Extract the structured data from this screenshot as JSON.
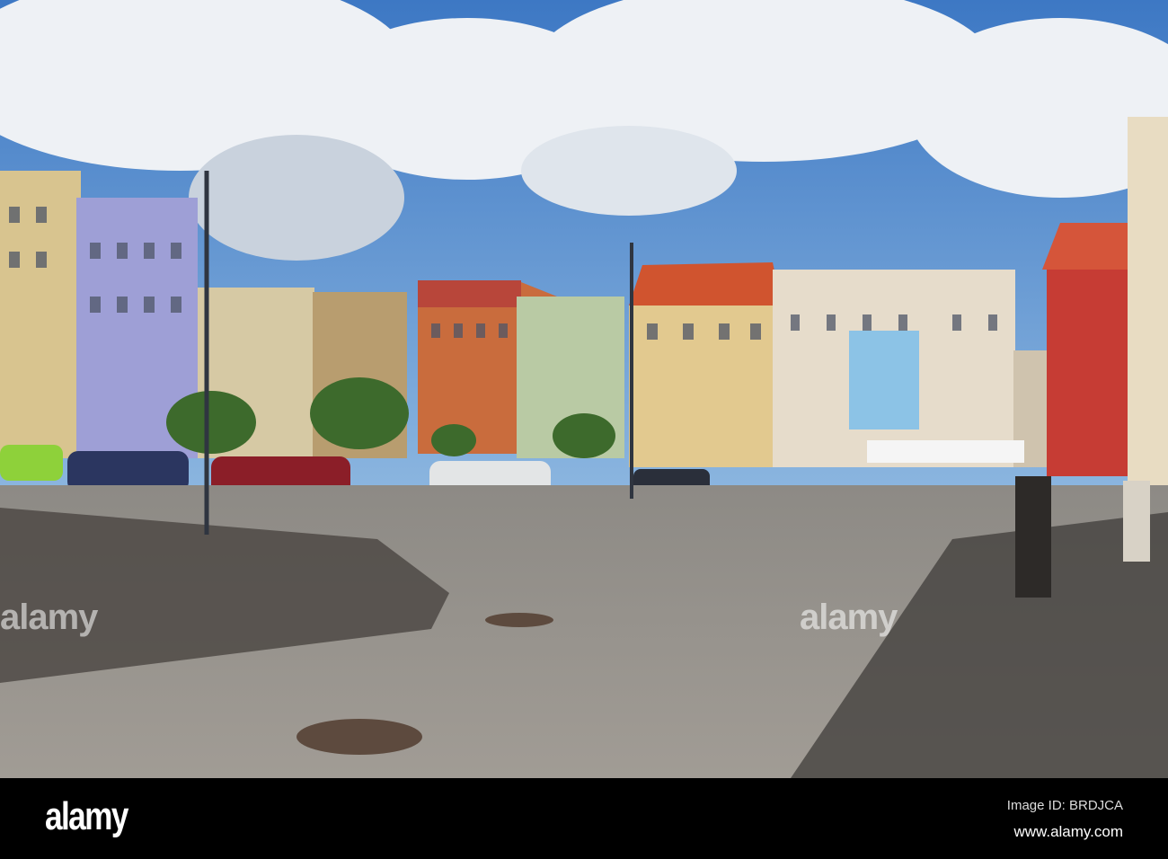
{
  "watermark": {
    "logo_text": "alamy",
    "overlay_text": "alamy"
  },
  "footer": {
    "logo": "alamy",
    "image_id": "Image ID: BRDJCA",
    "url": "www.alamy.com"
  }
}
